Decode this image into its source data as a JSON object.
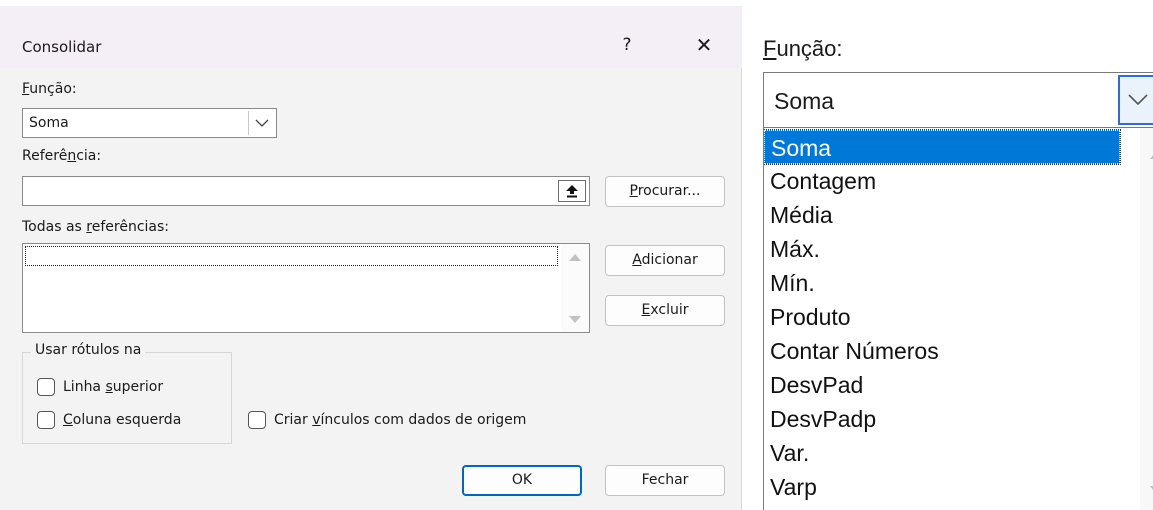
{
  "dialog": {
    "title": "Consolidar",
    "help_label": "?",
    "close_label": "✕",
    "function_label": "Função:",
    "function_value": "Soma",
    "reference_label": "Referência:",
    "reference_value": "",
    "browse_label": "Procurar...",
    "all_refs_label": "Todas as referências:",
    "add_label": "Adicionar",
    "delete_label": "Excluir",
    "labels_group_title": "Usar rótulos na",
    "top_row_label": "Linha superior",
    "left_column_label": "Coluna esquerda",
    "links_label": "Criar vínculos com dados de origem",
    "ok_label": "OK",
    "close_button_label": "Fechar"
  },
  "zoom": {
    "function_label": "Função:",
    "function_value": "Soma",
    "items": [
      "Soma",
      "Contagem",
      "Média",
      "Máx.",
      "Mín.",
      "Produto",
      "Contar Números",
      "DesvPad",
      "DesvPadp",
      "Var.",
      "Varp"
    ],
    "selected": "Soma"
  },
  "colors": {
    "accent": "#0078d7",
    "primary_border": "#0067c0",
    "titlebar": "#f4eef6",
    "dialog_bg": "#f3f3f3"
  },
  "icons": {
    "dropdown": "chevron-down-icon",
    "collapse": "collapse-dialog-icon",
    "scroll_up": "scroll-up-icon",
    "scroll_down": "scroll-down-icon"
  }
}
